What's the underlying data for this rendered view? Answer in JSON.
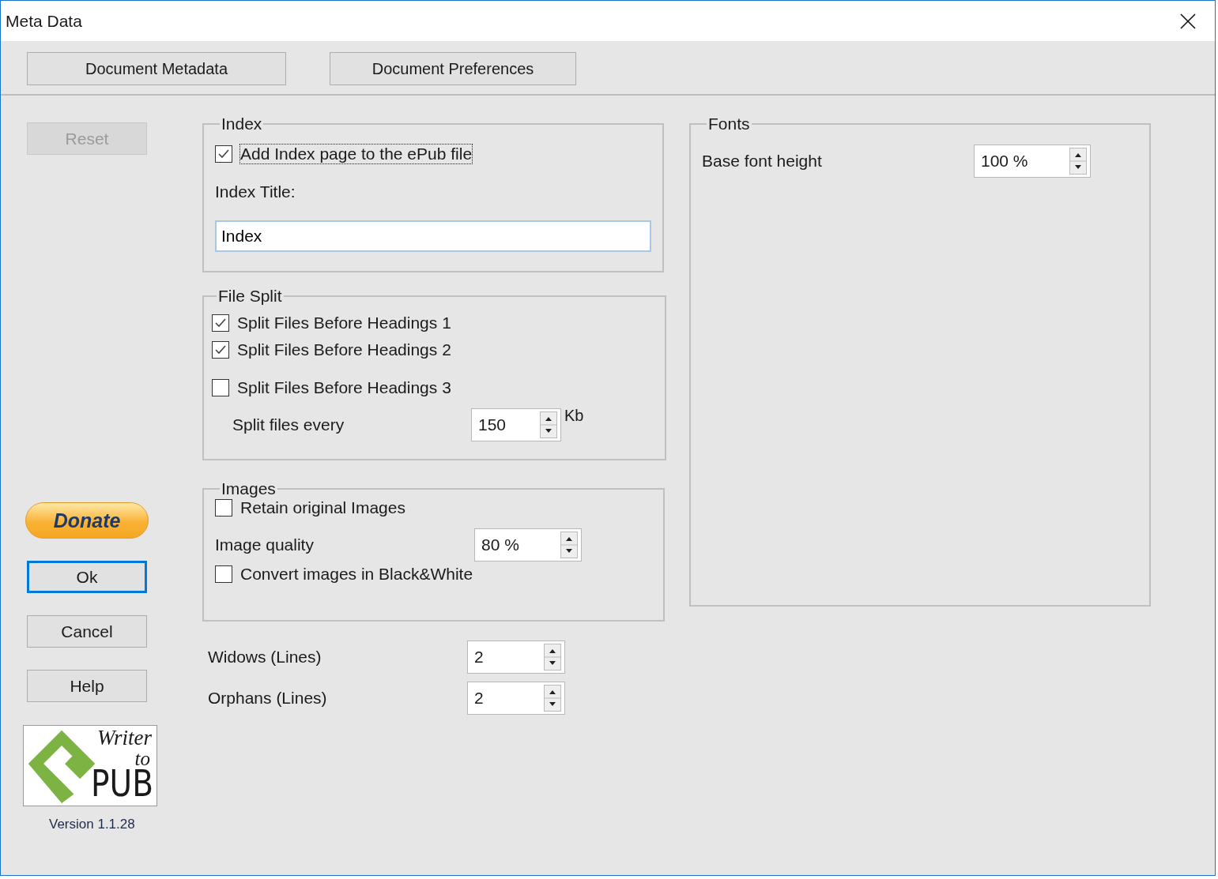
{
  "window": {
    "title": "Meta Data"
  },
  "tabs": [
    {
      "label": "Document Metadata",
      "selected": false
    },
    {
      "label": "Document Preferences",
      "selected": false
    }
  ],
  "side_buttons": [
    {
      "kind": "reset",
      "label": "Reset",
      "disabled": true,
      "default": false
    },
    {
      "kind": "donate",
      "label": "Donate",
      "disabled": false,
      "default": false
    },
    {
      "kind": "plain",
      "label": "Ok",
      "disabled": false,
      "default": true
    },
    {
      "kind": "plain",
      "label": "Cancel",
      "disabled": false,
      "default": false
    },
    {
      "kind": "plain",
      "label": "Help",
      "disabled": false,
      "default": false
    }
  ],
  "logo": {
    "lines": [
      "Writer",
      "to",
      "PUB"
    ]
  },
  "version": "Version 1.1.28",
  "index": {
    "title": "Index",
    "add_page": {
      "label": "Add Index page to the ePub file",
      "checked": true
    },
    "title_label": "Index Title:",
    "title_value": "Index"
  },
  "file_split": {
    "title": "File Split",
    "options": [
      {
        "label": "Split Files Before Headings 1",
        "checked": true
      },
      {
        "label": "Split Files Before Headings 2",
        "checked": true
      },
      {
        "label": "Split Files Before Headings 3",
        "checked": false
      }
    ],
    "every_label": "Split files every",
    "every_value": "150",
    "unit": "Kb"
  },
  "images": {
    "title": "Images",
    "retain": {
      "label": "Retain original Images",
      "checked": false
    },
    "quality_label": "Image quality",
    "quality_value": "80 %",
    "convert": {
      "label": "Convert images in Black&White",
      "checked": false
    }
  },
  "lines": [
    {
      "label": "Widows (Lines)",
      "value": "2"
    },
    {
      "label": "Orphans (Lines)",
      "value": "2"
    }
  ],
  "fonts": {
    "title": "Fonts",
    "base_label": "Base font height",
    "base_value": "100 %"
  }
}
